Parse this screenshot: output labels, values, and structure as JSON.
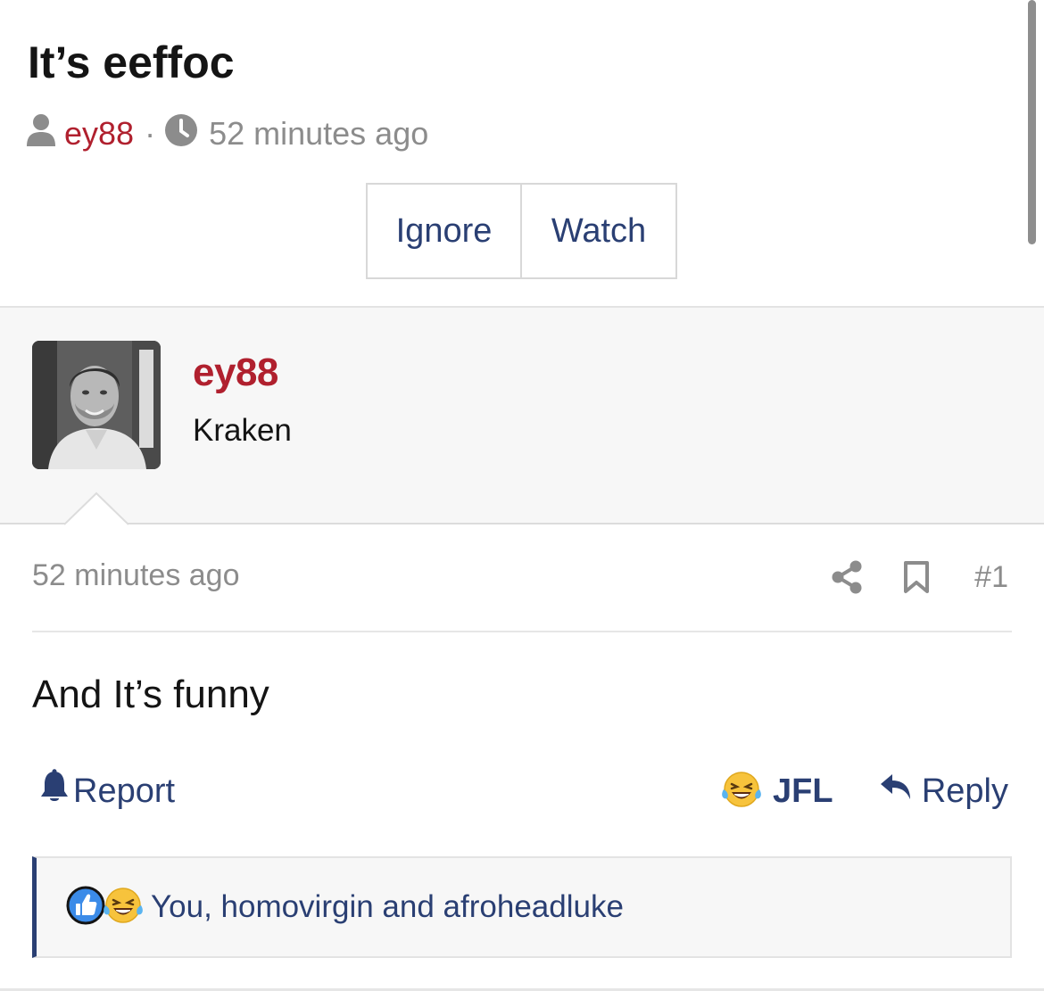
{
  "thread": {
    "title": "It’s eeffoc",
    "author": "ey88",
    "separator": "·",
    "time_ago": "52 minutes ago"
  },
  "thread_actions": {
    "ignore_label": "Ignore",
    "watch_label": "Watch"
  },
  "post": {
    "username": "ey88",
    "user_title": "Kraken",
    "date": "52 minutes ago",
    "number": "#1",
    "body": "And It’s funny",
    "actions": {
      "report_label": "Report",
      "reaction_label": "JFL",
      "reply_label": "Reply"
    },
    "reactions_summary": "You, homovirgin and afroheadluke"
  },
  "icons": {
    "author": "user-icon",
    "time": "clock-icon",
    "share": "share-icon",
    "bookmark": "bookmark-icon",
    "report": "bell-icon",
    "reaction": "laughing-crying-emoji-icon",
    "reply": "reply-arrow-icon",
    "like": "thumbs-up-icon"
  },
  "colors": {
    "username_red": "#b0202e",
    "link_navy": "#2a3f73",
    "muted_gray": "#8c8c8c"
  }
}
